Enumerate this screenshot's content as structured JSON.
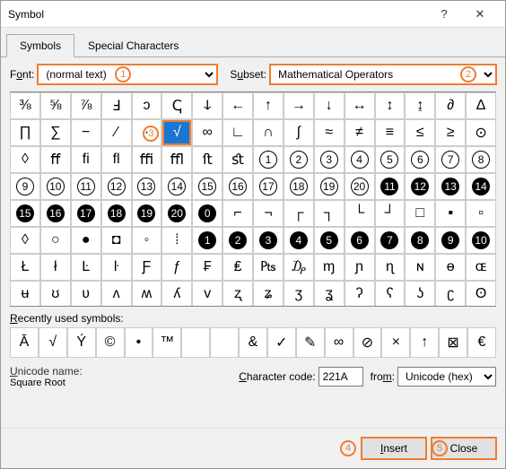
{
  "title": "Symbol",
  "help_icon": "?",
  "close_icon": "✕",
  "tabs": {
    "symbols": "Symbols",
    "special": "Special Characters"
  },
  "row1": {
    "font_label_pre": "F",
    "font_label_u": "o",
    "font_label_post": "nt:",
    "font_value": "(normal text)",
    "subset_label_pre": "S",
    "subset_label_u": "u",
    "subset_label_post": "bset:",
    "subset_value": "Mathematical Operators"
  },
  "badges": {
    "b1": "1",
    "b2": "2",
    "b3": "3",
    "b4": "4",
    "b5": "5"
  },
  "grid": [
    "⅜",
    "⅝",
    "⅞",
    "Ⅎ",
    "ↄ",
    "ↅ",
    "ↆ",
    "←",
    "↑",
    "→",
    "↓",
    "↔",
    "↕",
    "↨",
    "∂",
    "∆",
    "∏",
    "∑",
    "−",
    "∕",
    "∙",
    "_SEL_√",
    "∞",
    "∟",
    "∩",
    "∫",
    "≈",
    "≠",
    "≡",
    "≤",
    "≥",
    "⊙",
    "◊",
    "ﬀ",
    "ﬁ",
    "ﬂ",
    "ﬃ",
    "ﬄ",
    "ﬅ",
    "ﬆ",
    "_C_1",
    "_C_2",
    "_C_3",
    "_C_4",
    "_C_5",
    "_C_6",
    "_C_7",
    "_C_8",
    "_C_9",
    "_C_10",
    "_C_11",
    "_C_12",
    "_C_13",
    "_C_14",
    "_C_15",
    "_C_16",
    "_C_17",
    "_C_18",
    "_C_19",
    "_C_20",
    "_F_11",
    "_F_12",
    "_F_13",
    "_F_14",
    "_F_15",
    "_F_16",
    "_F_17",
    "_F_18",
    "_F_19",
    "_F_20",
    "_F_0",
    "⌐",
    "¬",
    "┌",
    "┐",
    "└",
    "┘",
    "□",
    "▪",
    "▫",
    "◊",
    "○",
    "●",
    "◘",
    "◦",
    "⁞",
    "_F_1",
    "_F_2",
    "_F_3",
    "_F_4",
    "_F_5",
    "_F_6",
    "_F_7",
    "_F_8",
    "_F_9",
    "_F_10",
    "Ł",
    "ł",
    "Ŀ",
    "ŀ",
    "Ƒ",
    "ƒ",
    "₣",
    "₤",
    "₧",
    "₯",
    "ɱ",
    "ɲ",
    "ɳ",
    "ɴ",
    "ɵ",
    "ɶ",
    "ʉ",
    "ʊ",
    "ʋ",
    "ʌ",
    "ʍ",
    "ʎ",
    "v",
    "ʐ",
    "ʑ",
    "ʒ",
    "ʓ",
    "ʔ",
    "ʕ",
    "ʖ",
    "ʗ",
    "ʘ"
  ],
  "recent_label": "Recently used symbols:",
  "recent": [
    "Ā",
    "√",
    "Ý",
    "©",
    "•",
    "™",
    "",
    "",
    "&",
    "✓",
    "✎",
    "∞",
    "⊘",
    "×",
    "↑",
    "⊠",
    "€"
  ],
  "info": {
    "uname_label_pre": "",
    "uname_label_u": "U",
    "uname_label_post": "nicode name:",
    "uname_value": "Square Root",
    "cc_label_pre": "",
    "cc_label_u": "C",
    "cc_label_post": "haracter code:",
    "cc_value": "221A",
    "from_label_pre": "fro",
    "from_label_u": "m",
    "from_label_post": ":",
    "from_value": "Unicode (hex)"
  },
  "footer": {
    "insert": "Insert",
    "close": "Close"
  }
}
